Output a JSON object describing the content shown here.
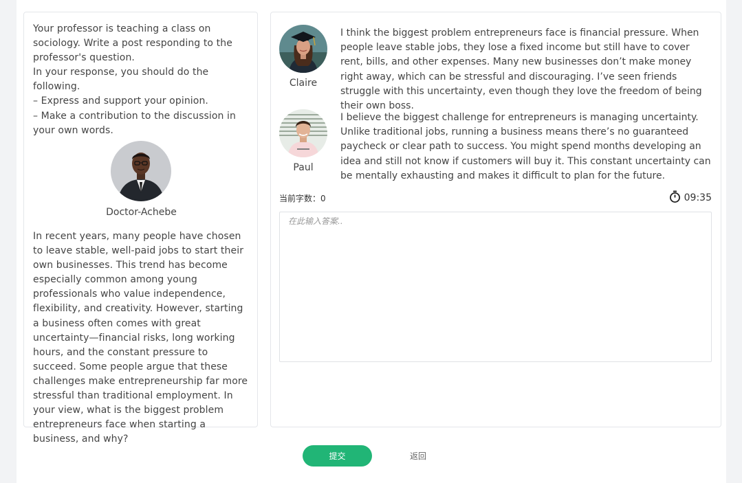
{
  "instructions": {
    "lines": [
      "Your professor is teaching a class on sociology. Write a post responding to the professor's question.",
      "In your response, you should do the following.",
      "– Express and support your opinion.",
      "– Make a contribution to the discussion in your own words."
    ]
  },
  "professor": {
    "name": "Doctor-Achebe",
    "avatar_icon": "professor-avatar",
    "question": "In recent years, many people have chosen to leave stable, well-paid jobs to start their own businesses. This trend has become especially common among young professionals who value independence, flexibility, and creativity. However, starting a business often comes with great uncertainty—financial risks, long working hours, and the constant pressure to succeed. Some people argue that these challenges make entrepreneurship far more stressful than traditional employment. In your view, what is the biggest problem entrepreneurs face when starting a business, and why?"
  },
  "students": [
    {
      "name": "Claire",
      "avatar_icon": "student-avatar-graduate",
      "text": "I think the biggest problem entrepreneurs face is financial pressure. When people leave stable jobs, they lose a fixed income but still have to cover rent, bills, and other expenses. Many new businesses don’t make money right away, which can be stressful and discouraging. I’ve seen friends struggle with this uncertainty, even though they love the freedom of being their own boss."
    },
    {
      "name": "Paul",
      "avatar_icon": "student-avatar",
      "text": "I believe the biggest challenge for entrepreneurs is managing uncertainty. Unlike traditional jobs, running a business means there’s no guaranteed paycheck or clear path to success. You might spend months developing an idea and still not know if customers will buy it. This constant uncertainty can be mentally exhausting and makes it difficult to plan for the future."
    }
  ],
  "editor": {
    "word_count_label": "当前字数：0",
    "timer": "09:35",
    "timer_icon": "stopwatch-icon",
    "placeholder": "在此输入答案.."
  },
  "actions": {
    "submit_label": "提交",
    "back_label": "返回"
  },
  "colors": {
    "accent": "#21b576"
  }
}
